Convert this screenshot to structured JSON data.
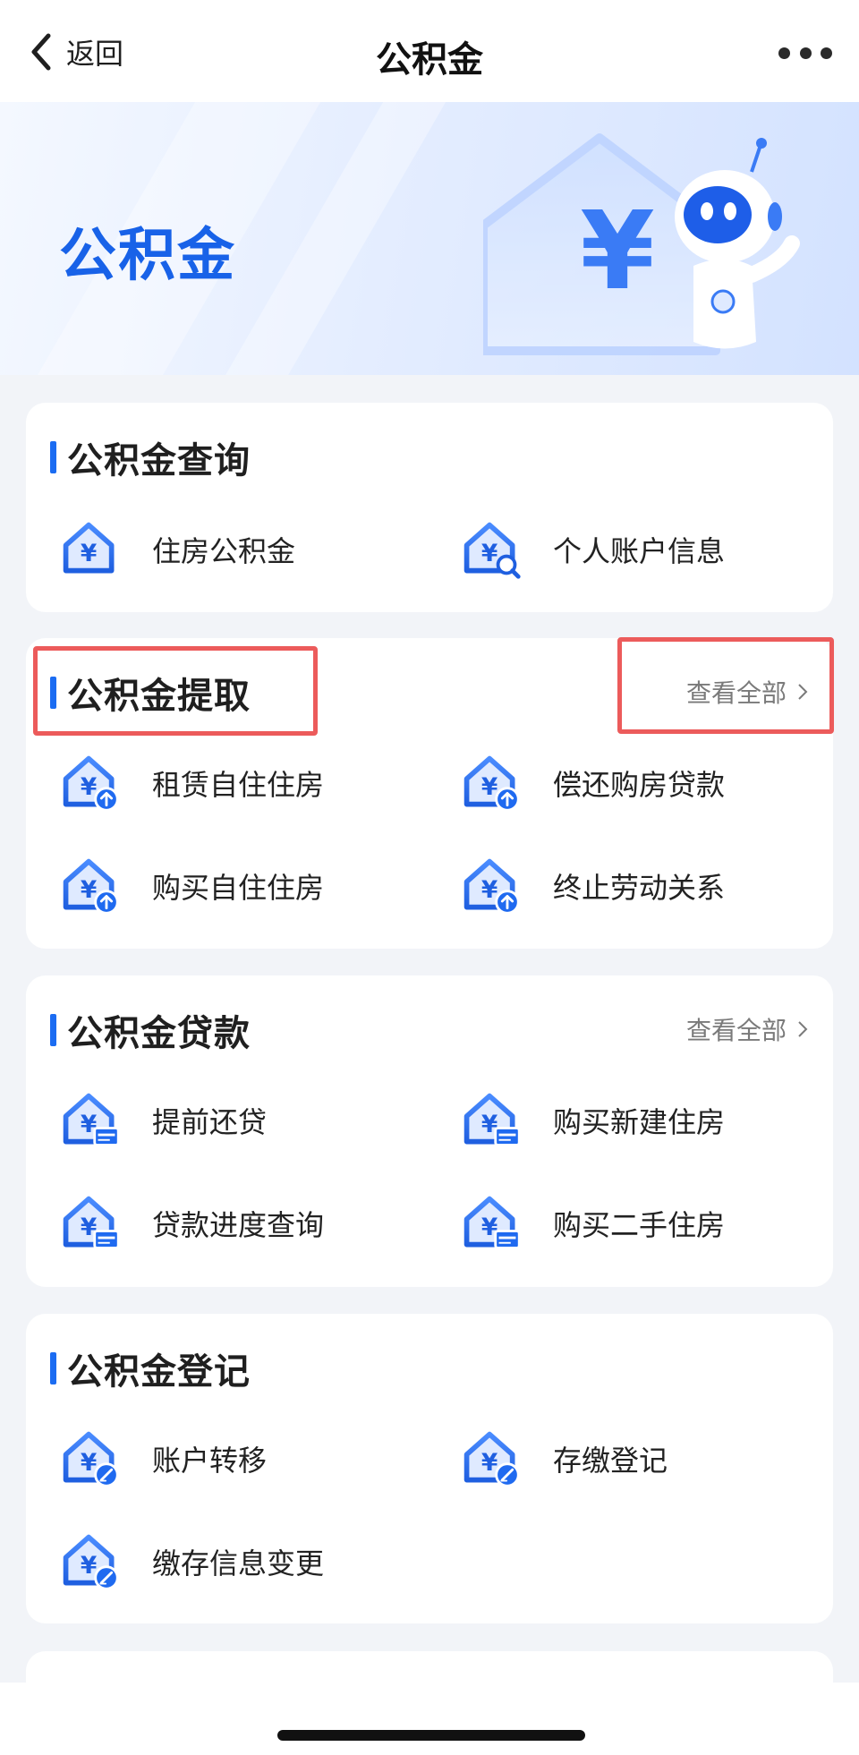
{
  "nav": {
    "back_label": "返回",
    "title": "公积金"
  },
  "banner": {
    "title": "公积金",
    "currency_symbol": "¥"
  },
  "sections": [
    {
      "title": "公积金查询",
      "view_all": "",
      "items": [
        {
          "label": "住房公积金",
          "icon": "house-yuan-icon"
        },
        {
          "label": "个人账户信息",
          "icon": "house-yuan-search-icon"
        }
      ]
    },
    {
      "title": "公积金提取",
      "view_all": "查看全部",
      "items": [
        {
          "label": "租赁自住住房",
          "icon": "house-yuan-upload-icon"
        },
        {
          "label": "偿还购房贷款",
          "icon": "house-yuan-upload-icon"
        },
        {
          "label": "购买自住住房",
          "icon": "house-yuan-upload-icon"
        },
        {
          "label": "终止劳动关系",
          "icon": "house-yuan-upload-icon"
        }
      ]
    },
    {
      "title": "公积金贷款",
      "view_all": "查看全部",
      "items": [
        {
          "label": "提前还贷",
          "icon": "house-yuan-card-icon"
        },
        {
          "label": "购买新建住房",
          "icon": "house-yuan-card-icon"
        },
        {
          "label": "贷款进度查询",
          "icon": "house-yuan-card-icon"
        },
        {
          "label": "购买二手住房",
          "icon": "house-yuan-card-icon"
        }
      ]
    },
    {
      "title": "公积金登记",
      "view_all": "",
      "items": [
        {
          "label": "账户转移",
          "icon": "house-yuan-edit-icon"
        },
        {
          "label": "存缴登记",
          "icon": "house-yuan-edit-icon"
        },
        {
          "label": "缴存信息变更",
          "icon": "house-yuan-edit-icon"
        }
      ]
    }
  ],
  "colors": {
    "accent": "#1b6cf2",
    "highlight": "#ec5b5b",
    "banner_title": "#1862e8"
  }
}
